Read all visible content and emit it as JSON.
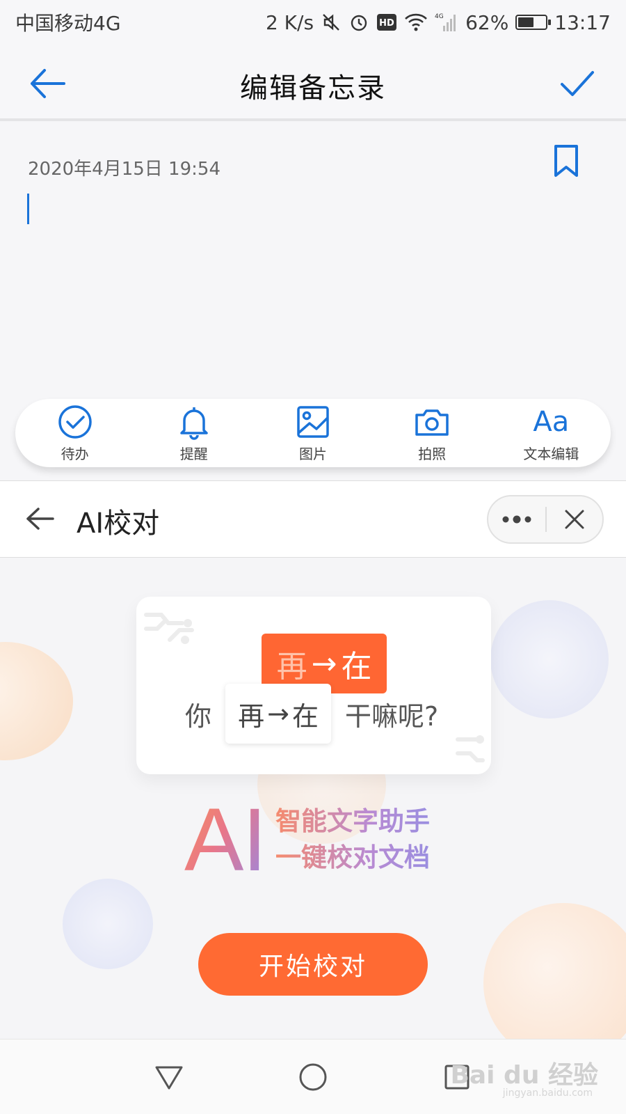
{
  "status_bar": {
    "carrier": "中国移动4G",
    "speed": "2 K/s",
    "battery": "62%",
    "battery_level": 0.62,
    "time": "13:17",
    "icons": [
      "mute-icon",
      "alarm-icon",
      "hd-icon",
      "wifi-icon",
      "signal-icon",
      "battery-icon"
    ]
  },
  "header": {
    "title": "编辑备忘录"
  },
  "note": {
    "date": "2020年4月15日 19:54",
    "body": ""
  },
  "toolbar": {
    "items": [
      {
        "label": "待办",
        "icon": "todo-check-icon"
      },
      {
        "label": "提醒",
        "icon": "bell-icon"
      },
      {
        "label": "图片",
        "icon": "image-icon"
      },
      {
        "label": "拍照",
        "icon": "camera-icon"
      },
      {
        "label": "文本编辑",
        "icon": "Aa"
      }
    ]
  },
  "ai_panel": {
    "title": "AI校对",
    "illustration": {
      "highlight_old": "再",
      "highlight_arrow": "→",
      "highlight_new": "在",
      "prefix": "你",
      "box_old": "再",
      "box_arrow": "→",
      "box_new": "在",
      "suffix": "干嘛呢?"
    },
    "logo": "AI",
    "slogan_line1": "智能文字助手",
    "slogan_line2": "一键校对文档",
    "start_button": "开始校对"
  },
  "watermark": {
    "brand": "Bai du 经验",
    "url": "jingyan.baidu.com"
  },
  "colors": {
    "accent_blue": "#1a73d9",
    "accent_orange": "#ff6a33"
  }
}
